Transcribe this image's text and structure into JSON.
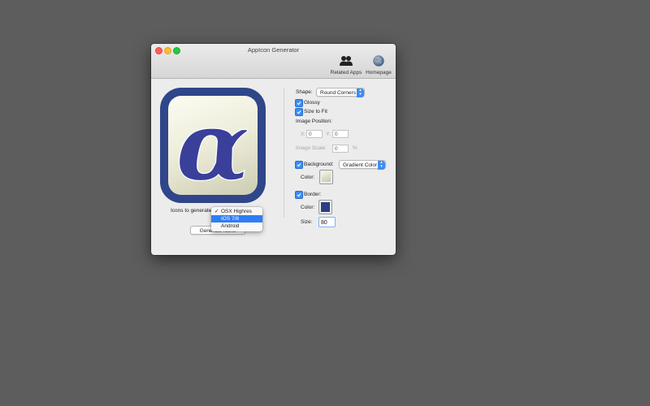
{
  "window": {
    "title": "AppIcon Generator"
  },
  "toolbar": {
    "related_apps_label": "Related Apps",
    "homepage_label": "Homepage"
  },
  "icon_preview": {
    "glyph": "α",
    "frame_color": "#2f468a",
    "glyph_color": "#3a3f9a"
  },
  "generate": {
    "icons_label": "Icons to generate",
    "button_label": "Generate Icons",
    "menu": [
      {
        "label": "OSX Highres",
        "checked": true,
        "highlighted": false
      },
      {
        "label": "IOS 7/8",
        "checked": false,
        "highlighted": true
      },
      {
        "label": "Android",
        "checked": false,
        "highlighted": false
      }
    ]
  },
  "settings": {
    "shape_label": "Shape:",
    "shape_value": "Round Corners",
    "glossy_label": "Glossy",
    "glossy_checked": true,
    "size_to_fit_label": "Size to Fit",
    "size_to_fit_checked": true,
    "image_position_label": "Image Position:",
    "x_label": "X:",
    "x_value": "0",
    "y_label": "Y:",
    "y_value": "0",
    "image_scale_label": "Image Scale:",
    "image_scale_value": "0",
    "percent_label": "%",
    "background_label": "Background:",
    "background_checked": true,
    "background_type": "Gradient Color",
    "bg_color_label": "Color:",
    "bg_color": "#d9d9c3",
    "border_label": "Border:",
    "border_checked": true,
    "border_color_label": "Color:",
    "border_color": "#2b3f86",
    "size_label": "Size:",
    "size_value": "80"
  },
  "colors": {
    "accent": "#3b8df5",
    "background": "#5d5d5d"
  }
}
